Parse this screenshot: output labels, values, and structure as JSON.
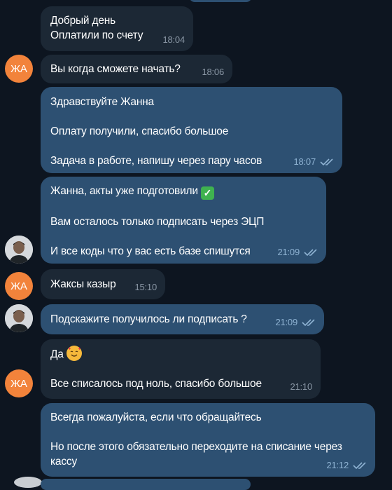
{
  "contacts": {
    "avatar_ja_initials": "ЖА"
  },
  "messages": [
    {
      "lines": [
        "Добрый день",
        "Оплатили по счету"
      ],
      "time": "18:04"
    },
    {
      "lines": [
        "Вы когда сможете начать?"
      ],
      "time": "18:06"
    },
    {
      "lines": [
        "Здравствуйте Жанна",
        "",
        "Оплату получили, спасибо большое",
        "",
        "Задача в работе, напишу через пару часов"
      ],
      "time": "18:07",
      "read": true
    },
    {
      "lines": [
        "Жанна, акты уже подготовили",
        "",
        "Вам осталось только подписать через ЭЦП",
        "",
        "И все коды что у вас есть базе спишутся"
      ],
      "time": "21:09",
      "read": true,
      "emoji": "check-mark-button"
    },
    {
      "lines": [
        "Жаксы казыр"
      ],
      "time": "15:10"
    },
    {
      "lines": [
        "Подскажите получилось ли подписать ?"
      ],
      "time": "21:09",
      "read": true
    },
    {
      "lines": [
        "Да",
        "",
        "Все списалось под ноль, спасибо большое"
      ],
      "time": "21:10",
      "emoji": "smiling-face-with-hearts"
    },
    {
      "lines": [
        "Всегда пожалуйста, если что обращайтесь",
        "",
        "Но после этого обязательно переходите на списание через",
        "кассу"
      ],
      "time": "21:12",
      "read": true
    }
  ],
  "colors": {
    "background": "#0d1520",
    "incoming": "#1c2835",
    "outgoing": "#2d5072",
    "avatar_ja": "#f2833b"
  }
}
